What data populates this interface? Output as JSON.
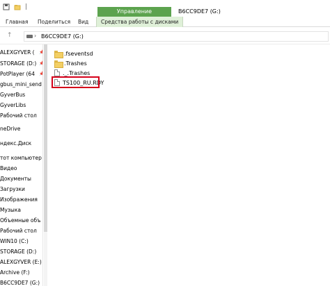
{
  "window": {
    "title": "B6CC9DE7 (G:)",
    "manage_tab": "Управление"
  },
  "ribbon": {
    "tabs": [
      "Главная",
      "Поделиться",
      "Вид"
    ],
    "drive_tools_tab": "Средства работы с дисками"
  },
  "address": {
    "path": "B6CC9DE7 (G:)"
  },
  "nav_pane": {
    "items": [
      {
        "label": "ALEXGYVER (",
        "pinned": true
      },
      {
        "label": "STORAGE (D:)",
        "pinned": true
      },
      {
        "label": "PotPlayer (64",
        "pinned": true
      },
      {
        "label": "gbus_mini_send",
        "pinned": false
      },
      {
        "label": "GyverBus",
        "pinned": false
      },
      {
        "label": "GyverLibs",
        "pinned": false
      },
      {
        "label": "Рабочий стол",
        "pinned": false
      },
      {
        "label": "neDrive",
        "pinned": false
      },
      {
        "label": "ндекс.Диск",
        "pinned": false
      },
      {
        "label": "тот компьютер",
        "pinned": false
      },
      {
        "label": "Видео",
        "pinned": false
      },
      {
        "label": "Документы",
        "pinned": false
      },
      {
        "label": "Загрузки",
        "pinned": false
      },
      {
        "label": "Изображения",
        "pinned": false
      },
      {
        "label": "Музыка",
        "pinned": false
      },
      {
        "label": "Объемные объ",
        "pinned": false
      },
      {
        "label": "Рабочий стол",
        "pinned": false
      },
      {
        "label": "WIN10 (C:)",
        "pinned": false
      },
      {
        "label": "STORAGE (D:)",
        "pinned": false
      },
      {
        "label": "ALEXGYVER (E:)",
        "pinned": false
      },
      {
        "label": "Archive (F:)",
        "pinned": false
      },
      {
        "label": "B6CC9DE7 (G:)",
        "pinned": false
      }
    ]
  },
  "files": [
    {
      "name": ".fseventsd",
      "type": "folder"
    },
    {
      "name": ".Trashes",
      "type": "folder"
    },
    {
      "name": "._.Trashes",
      "type": "file"
    },
    {
      "name": "TS100_RU.RDY",
      "type": "file",
      "highlighted": true
    }
  ],
  "colors": {
    "manage_band": "#5ca34e",
    "highlight": "#d5001a"
  }
}
